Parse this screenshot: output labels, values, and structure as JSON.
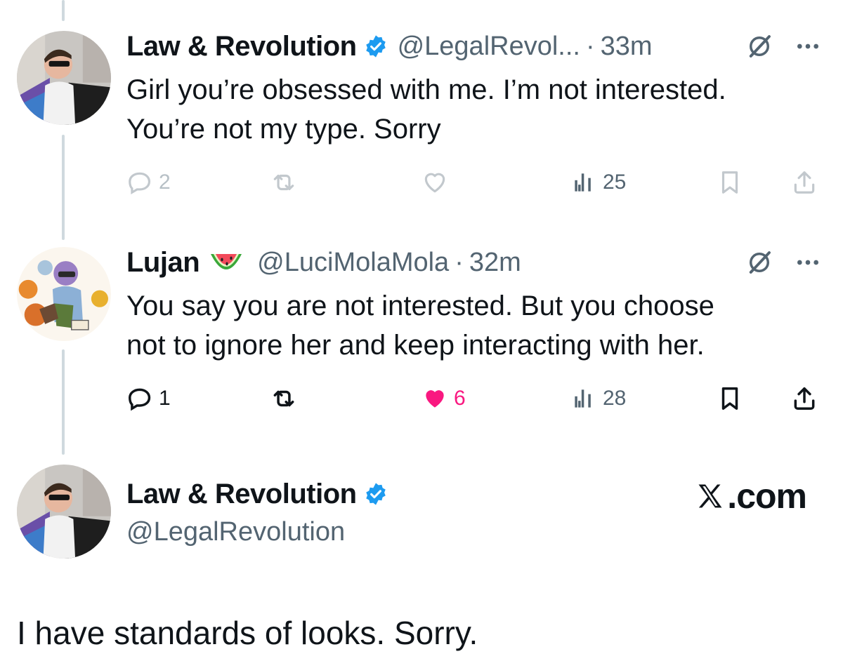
{
  "tweets": [
    {
      "display_name": "Law & Revolution",
      "verified": true,
      "handle": "@LegalRevol...",
      "separator": "·",
      "time": "33m",
      "text_lines": [
        "Girl you’re obsessed with me. I’m not interested.",
        "You’re not my type. Sorry"
      ],
      "actions": {
        "replies": "2",
        "retweets": "",
        "likes": "",
        "views": "25"
      },
      "liked": false
    },
    {
      "display_name": "Lujan",
      "emoji": "🍉",
      "verified": false,
      "handle": "@LuciMolaMola",
      "separator": "·",
      "time": "32m",
      "text_lines": [
        "You say you are not interested. But you choose",
        "not to ignore her and keep interacting with her."
      ],
      "actions": {
        "replies": "1",
        "retweets": "",
        "likes": "6",
        "views": "28"
      },
      "liked": true
    }
  ],
  "main_post": {
    "display_name": "Law & Revolution",
    "verified": true,
    "handle": "@LegalRevolution",
    "text": "I have standards of looks. Sorry."
  },
  "watermark": {
    "text": ".com",
    "icon": "x-logo-icon"
  },
  "colors": {
    "verified_blue": "#1d9bf0",
    "like_pink": "#f91880",
    "secondary_text": "#536471",
    "thread_line": "#cfd9de"
  },
  "icons": [
    "reply-icon",
    "retweet-icon",
    "like-icon",
    "views-icon",
    "bookmark-icon",
    "share-icon",
    "grok-icon",
    "more-icon",
    "verified-badge-icon"
  ]
}
